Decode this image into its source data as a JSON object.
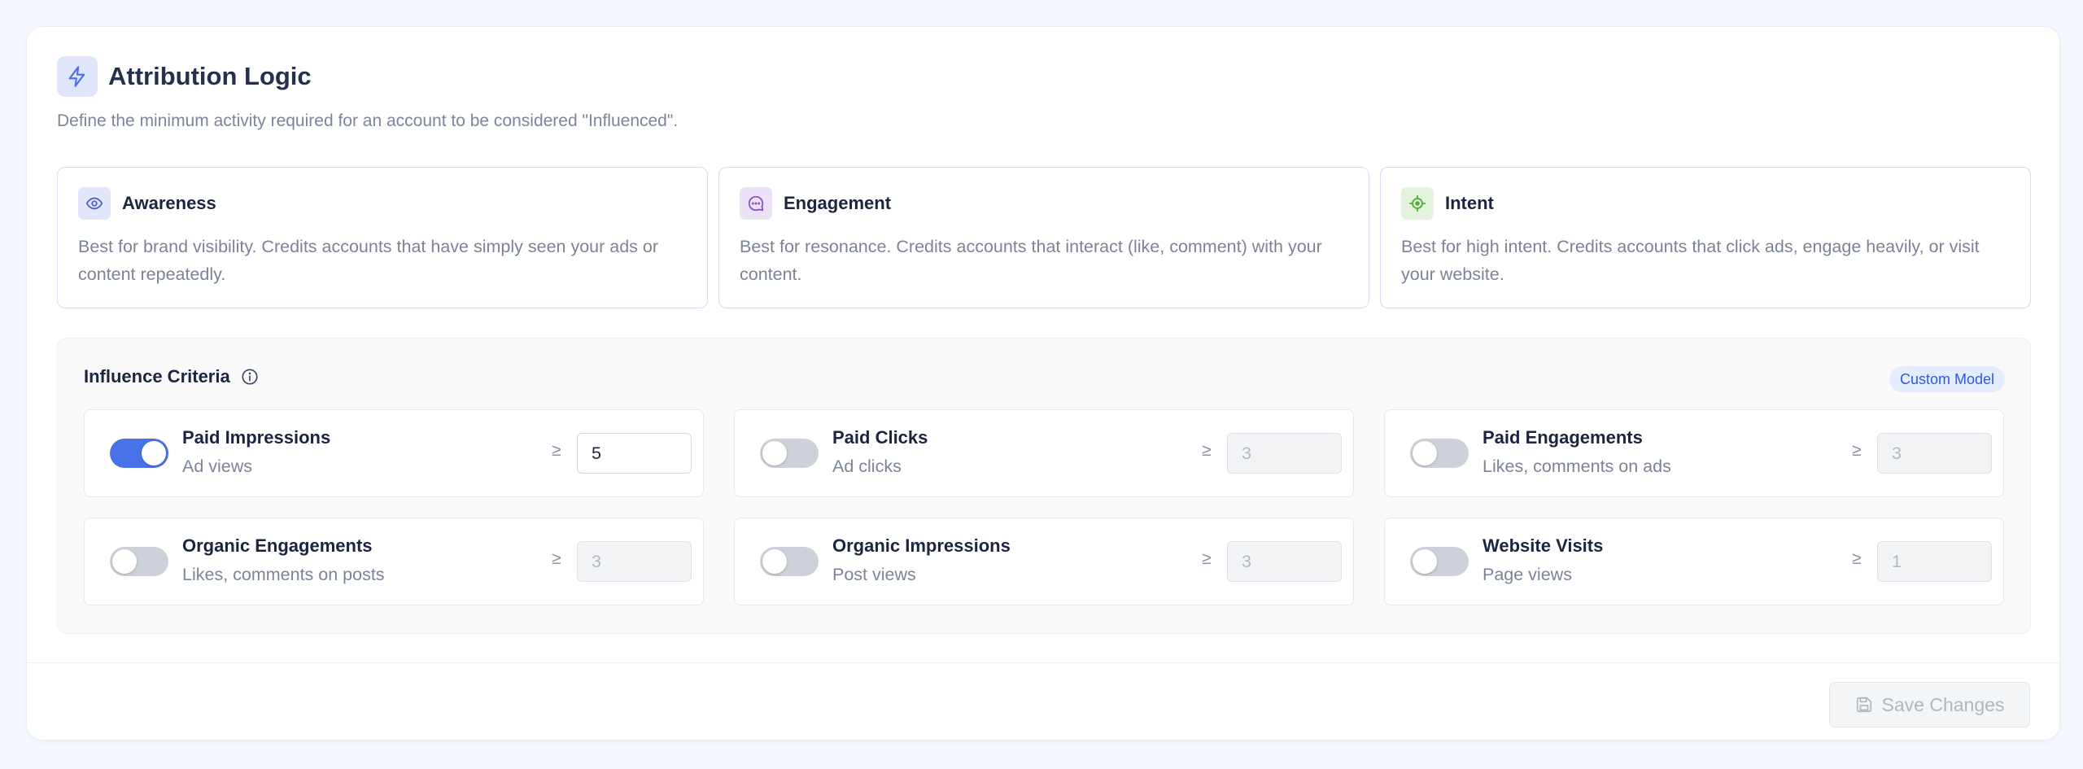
{
  "header": {
    "title": "Attribution Logic",
    "subtitle": "Define the minimum activity required for an account to be considered \"Influenced\".",
    "icon": "lightning-icon"
  },
  "models": [
    {
      "name": "Awareness",
      "icon": "eye-icon",
      "color": "#4b62c9",
      "bg": "#e2e6fa",
      "description": "Best for brand visibility. Credits accounts that have simply seen your ads or content repeatedly."
    },
    {
      "name": "Engagement",
      "icon": "chat-icon",
      "color": "#8a52c7",
      "bg": "#ece2f8",
      "description": "Best for resonance. Credits accounts that interact (like, comment) with your content."
    },
    {
      "name": "Intent",
      "icon": "target-icon",
      "color": "#4fae3b",
      "bg": "#e3f3dd",
      "description": "Best for high intent. Credits accounts that click ads, engage heavily, or visit your website."
    }
  ],
  "criteria": {
    "title": "Influence Criteria",
    "badge": "Custom Model",
    "gte_symbol": "≥",
    "rules": [
      {
        "label": "Paid Impressions",
        "sub": "Ad views",
        "enabled": true,
        "value": "5"
      },
      {
        "label": "Paid Clicks",
        "sub": "Ad clicks",
        "enabled": false,
        "value": "3"
      },
      {
        "label": "Paid Engagements",
        "sub": "Likes, comments on ads",
        "enabled": false,
        "value": "3"
      },
      {
        "label": "Organic Engagements",
        "sub": "Likes, comments on posts",
        "enabled": false,
        "value": "3"
      },
      {
        "label": "Organic Impressions",
        "sub": "Post views",
        "enabled": false,
        "value": "3"
      },
      {
        "label": "Website Visits",
        "sub": "Page views",
        "enabled": false,
        "value": "1"
      }
    ]
  },
  "footer": {
    "save_label": "Save Changes",
    "save_icon": "save-icon"
  },
  "colors": {
    "accent": "#4a72e8",
    "badge_bg": "#e4edff",
    "badge_text": "#2e5bd8"
  }
}
